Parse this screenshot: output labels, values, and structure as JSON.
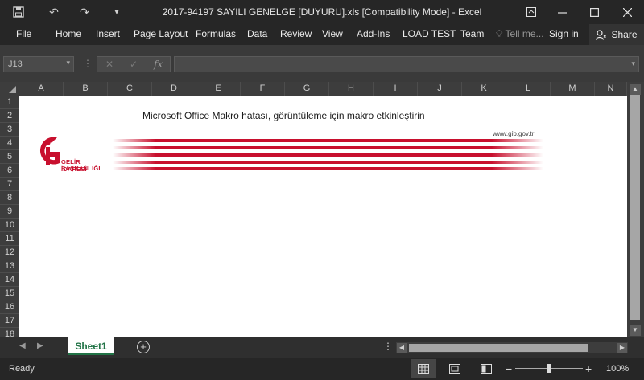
{
  "window": {
    "title": "2017-94197 SAYILI GENELGE [DUYURU].xls  [Compatibility Mode] - Excel"
  },
  "ribbon": {
    "tabs": [
      "File",
      "Home",
      "Insert",
      "Page Layout",
      "Formulas",
      "Data",
      "Review",
      "View",
      "Add-Ins",
      "LOAD TEST",
      "Team"
    ],
    "tell_me": "Tell me...",
    "sign_in": "Sign in",
    "share": "Share"
  },
  "formula_bar": {
    "name_box": "J13",
    "formula": ""
  },
  "grid": {
    "columns": [
      "A",
      "B",
      "C",
      "D",
      "E",
      "F",
      "G",
      "H",
      "I",
      "J",
      "K",
      "L",
      "M",
      "N"
    ],
    "rows": [
      "1",
      "2",
      "3",
      "4",
      "5",
      "6",
      "7",
      "8",
      "9",
      "10",
      "11",
      "12",
      "13",
      "14",
      "15",
      "16",
      "17",
      "18"
    ]
  },
  "content": {
    "message": "Microsoft Office Makro hatası, görüntüleme için makro etkinleştirin",
    "website": "www.gib.gov.tr",
    "logo_line1": "GELİR İDARESİ",
    "logo_line2": "BAŞKANLIĞI",
    "brand_color": "#c8102e"
  },
  "sheets": {
    "active": "Sheet1"
  },
  "status": {
    "text": "Ready",
    "zoom": "100%"
  }
}
